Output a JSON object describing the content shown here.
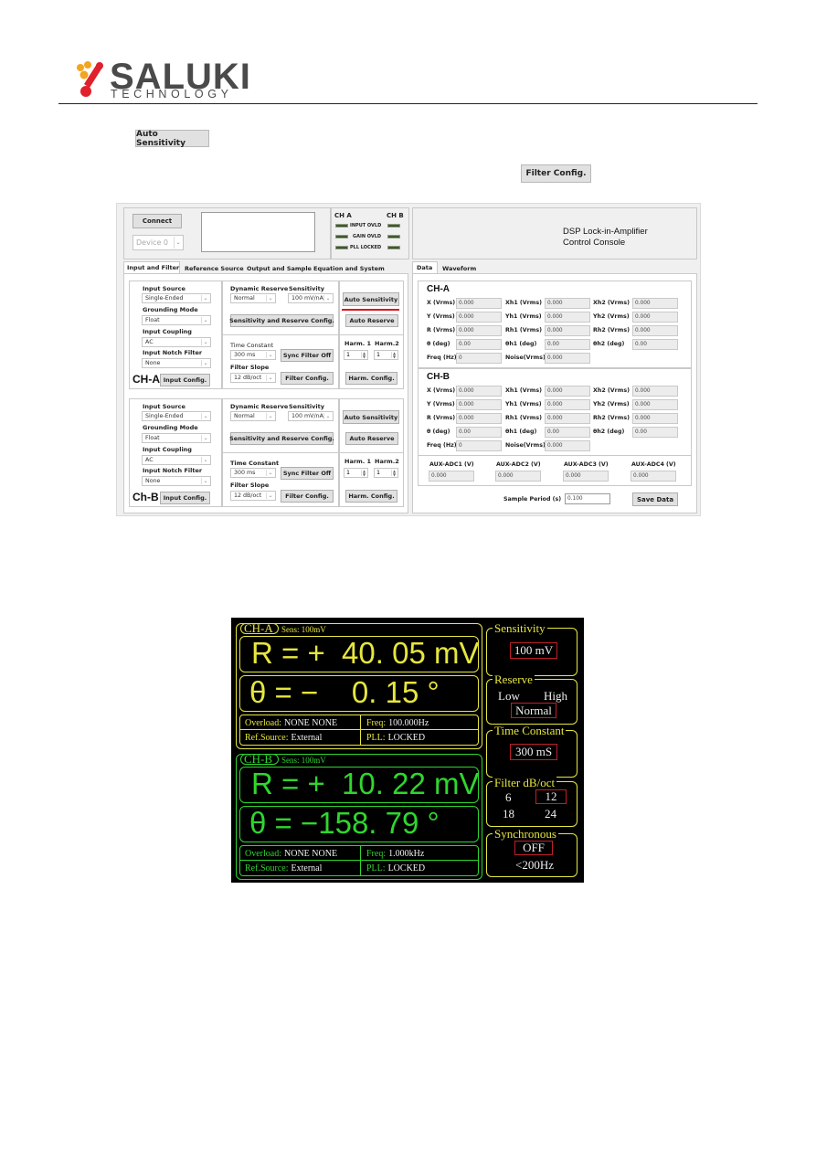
{
  "header": {
    "brand": "SALUKI",
    "brand_sub": "TECHNOLOGY",
    "colors": {
      "brand_red": "#e0202a",
      "brand_orange": "#f2a51e",
      "brand_gray": "#4a4a4a"
    }
  },
  "inline_buttons": {
    "auto_sensitivity": "Auto Sensitivity",
    "filter_config": "Filter Config."
  },
  "window": {
    "connect_label": "Connect",
    "device_select": "Device 0",
    "leds": {
      "ch_a": "CH A",
      "ch_b": "CH B",
      "rows": [
        "INPUT OVLD",
        "GAIN OVLD",
        "PLL LOCKED"
      ]
    },
    "console_title_1": "DSP Lock-in-Amplifier",
    "console_title_2": "Control Console",
    "left_tabs": [
      "Input and Filter",
      "Reference Source",
      "Output and Sample",
      "Equation and System"
    ],
    "right_tabs": [
      "Data",
      "Waveform"
    ],
    "channels": [
      {
        "name": "CH-A",
        "input_source_label": "Input Source",
        "input_source": "Single-Ended",
        "grounding_label": "Grounding Mode",
        "grounding": "Float",
        "coupling_label": "Input Coupling",
        "coupling": "AC",
        "notch_label": "Input Notch Filter",
        "notch": "None",
        "input_config": "Input Config.",
        "reserve_label": "Dynamic Reserve",
        "reserve": "Normal",
        "sensitivity_label": "Sensitivity",
        "sensitivity": "100 mV/nA",
        "auto_sensitivity": "Auto Sensitivity",
        "sens_reserve_config": "Sensitivity and Reserve Config.",
        "auto_reserve": "Auto Reserve",
        "time_constant_label": "Time Constant",
        "time_constant": "300 ms",
        "sync_filter": "Sync Filter Off",
        "filter_slope_label": "Filter Slope",
        "filter_slope": "12 dB/oct",
        "filter_config": "Filter Config.",
        "harm1_label": "Harm. 1",
        "harm1": "1",
        "harm2_label": "Harm.2",
        "harm2": "1",
        "harm_config": "Harm. Config."
      },
      {
        "name": "Ch-B",
        "input_source_label": "Input Source",
        "input_source": "Single-Ended",
        "grounding_label": "Grounding Mode",
        "grounding": "Float",
        "coupling_label": "Input Coupling",
        "coupling": "AC",
        "notch_label": "Input Notch Filter",
        "notch": "None",
        "input_config": "Input Config.",
        "reserve_label": "Dynamic Reserve",
        "reserve": "Normal",
        "sensitivity_label": "Sensitivity",
        "sensitivity": "100 mV/nA",
        "auto_sensitivity": "Auto Sensitivity",
        "sens_reserve_config": "Sensitivity and Reserve Config.",
        "auto_reserve": "Auto Reserve",
        "time_constant_label": "Time Constant",
        "time_constant": "300 ms",
        "sync_filter": "Sync Filter Off",
        "filter_slope_label": "Filter Slope",
        "filter_slope": "12 dB/oct",
        "filter_config": "Filter Config.",
        "harm1_label": "Harm. 1",
        "harm1": "1",
        "harm2_label": "Harm.2",
        "harm2": "1",
        "harm_config": "Harm. Config."
      }
    ],
    "data": {
      "channels": [
        {
          "name": "CH-A",
          "rows": [
            [
              {
                "l": "X (Vrms)",
                "v": "0.000"
              },
              {
                "l": "Xh1 (Vrms)",
                "v": "0.000"
              },
              {
                "l": "Xh2 (Vrms)",
                "v": "0.000"
              }
            ],
            [
              {
                "l": "Y (Vrms)",
                "v": "0.000"
              },
              {
                "l": "Yh1 (Vrms)",
                "v": "0.000"
              },
              {
                "l": "Yh2 (Vrms)",
                "v": "0.000"
              }
            ],
            [
              {
                "l": "R (Vrms)",
                "v": "0.000"
              },
              {
                "l": "Rh1 (Vrms)",
                "v": "0.000"
              },
              {
                "l": "Rh2 (Vrms)",
                "v": "0.000"
              }
            ],
            [
              {
                "l": "θ  (deg)",
                "v": "0.00"
              },
              {
                "l": "θh1  (deg)",
                "v": "0.00"
              },
              {
                "l": "θh2  (deg)",
                "v": "0.00"
              }
            ],
            [
              {
                "l": "Freq (Hz)",
                "v": "0"
              },
              {
                "l": "Noise(Vrms)",
                "v": "0.000"
              }
            ]
          ]
        },
        {
          "name": "CH-B",
          "rows": [
            [
              {
                "l": "X (Vrms)",
                "v": "0.000"
              },
              {
                "l": "Xh1 (Vrms)",
                "v": "0.000"
              },
              {
                "l": "Xh2 (Vrms)",
                "v": "0.000"
              }
            ],
            [
              {
                "l": "Y (Vrms)",
                "v": "0.000"
              },
              {
                "l": "Yh1 (Vrms)",
                "v": "0.000"
              },
              {
                "l": "Yh2 (Vrms)",
                "v": "0.000"
              }
            ],
            [
              {
                "l": "R (Vrms)",
                "v": "0.000"
              },
              {
                "l": "Rh1 (Vrms)",
                "v": "0.000"
              },
              {
                "l": "Rh2 (Vrms)",
                "v": "0.000"
              }
            ],
            [
              {
                "l": "θ  (deg)",
                "v": "0.00"
              },
              {
                "l": "θh1  (deg)",
                "v": "0.00"
              },
              {
                "l": "θh2  (deg)",
                "v": "0.00"
              }
            ],
            [
              {
                "l": "Freq (Hz)",
                "v": "0"
              },
              {
                "l": "Noise(Vrms)",
                "v": "0.000"
              }
            ]
          ]
        }
      ],
      "aux": [
        {
          "l": "AUX-ADC1 (V)",
          "v": "0.000"
        },
        {
          "l": "AUX-ADC2 (V)",
          "v": "0.000"
        },
        {
          "l": "AUX-ADC3 (V)",
          "v": "0.000"
        },
        {
          "l": "AUX-ADC4 (V)",
          "v": "0.000"
        }
      ],
      "sample_period_label": "Sample Period (s)",
      "sample_period": "0.100",
      "save_data": "Save Data"
    }
  },
  "lcd": {
    "colors": {
      "ch_a": "#e6e640",
      "ch_b": "#2fd62f",
      "highlight": "#c0202a"
    },
    "ch_a": {
      "title": "CH-A",
      "sens": "Sens: 100mV",
      "r_line": "R = +  40. 05 mV",
      "theta_line": "θ = −    0. 15 °",
      "overload_label": "Overload:",
      "overload": "NONE  NONE",
      "freq_label": "Freq:",
      "freq": "100.000Hz",
      "ref_label": "Ref.Source:",
      "ref": "External",
      "pll_label": "PLL:",
      "pll": "LOCKED"
    },
    "ch_b": {
      "title": "CH-B",
      "sens": "Sens: 100mV",
      "r_line": "R = +  10. 22 mV",
      "theta_line": "θ = −158. 79 °",
      "overload_label": "Overload:",
      "overload": "NONE  NONE",
      "freq_label": "Freq:",
      "freq": "1.000kHz",
      "ref_label": "Ref.Source:",
      "ref": "External",
      "pll_label": "PLL:",
      "pll": "LOCKED"
    },
    "side": {
      "sensitivity_title": "Sensitivity",
      "sensitivity": "100 mV",
      "reserve_title": "Reserve",
      "reserve_low": "Low",
      "reserve_high": "High",
      "reserve": "Normal",
      "tc_title": "Time Constant",
      "tc": "300 mS",
      "filter_title": "Filter dB/oct",
      "filter_options": [
        "6",
        "12",
        "18",
        "24"
      ],
      "filter_selected": "12",
      "sync_title": "Synchronous",
      "sync": "OFF",
      "sync_note": "<200Hz"
    }
  }
}
